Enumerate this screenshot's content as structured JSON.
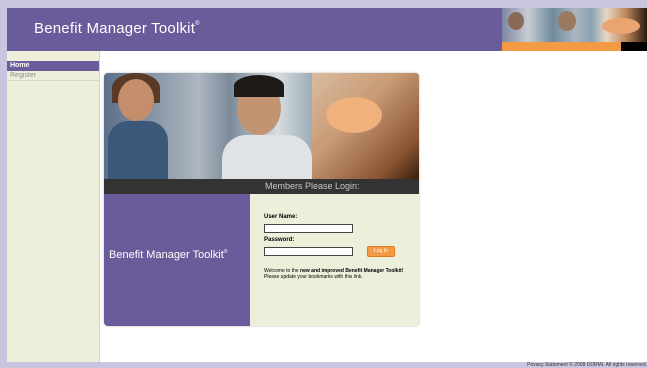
{
  "header": {
    "title": "Benefit Manager Toolkit",
    "title_mark": "®"
  },
  "sidebar": {
    "items": [
      {
        "label": "Home",
        "active": true
      },
      {
        "label": "Register",
        "active": false
      }
    ]
  },
  "login": {
    "banner": "Members Please Login:",
    "brand": "Benefit Manager Toolkit",
    "brand_mark": "®",
    "username_label": "User Name:",
    "password_label": "Password:",
    "username_value": "",
    "password_value": "",
    "button_label": "Log In",
    "welcome_prefix": "Welcome to the ",
    "welcome_bold": "new and improved Benefit Manager Toolkit!",
    "welcome_suffix": "Please update your bookmarks with this link."
  },
  "footer": {
    "text": "Privacy Statement  © 2008 DDRMI. All rights reserved."
  },
  "colors": {
    "brand_purple": "#6a5b9b",
    "accent_orange": "#f29a44",
    "sidebar_bg": "#edefdb",
    "banner_dark": "#333333"
  },
  "icons": {
    "header_photo": "people-collage-photo",
    "hero_photo": "customer-service-collage-photo"
  }
}
